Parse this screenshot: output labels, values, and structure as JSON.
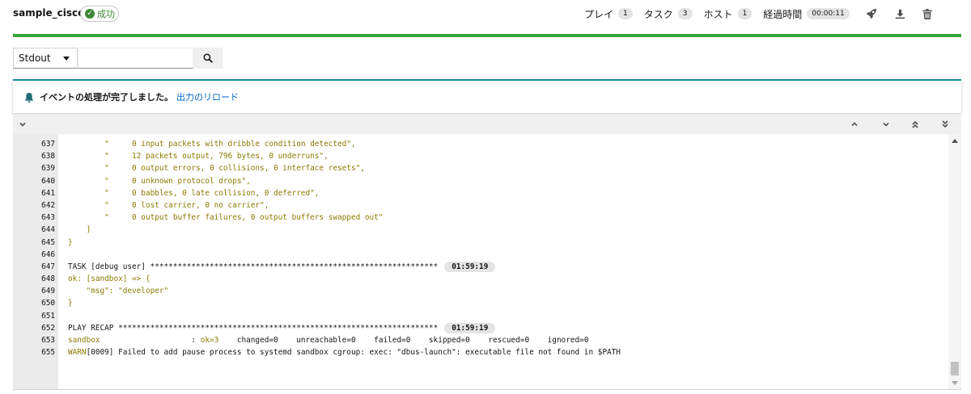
{
  "header": {
    "title": "sample_cisco",
    "status": "成功",
    "counts": [
      {
        "label": "プレイ",
        "value": "1"
      },
      {
        "label": "タスク",
        "value": "3"
      },
      {
        "label": "ホスト",
        "value": "1"
      },
      {
        "label": "経過時間",
        "value": "00:00:11"
      }
    ],
    "icons": [
      "rocket-icon",
      "download-icon",
      "delete-icon"
    ]
  },
  "colors": {
    "success": "#3e8635",
    "progress_bar": "#3ca739",
    "alert_border": "#1f8b9a",
    "link": "#0066cc",
    "output_ok": "#8a7a00"
  },
  "search": {
    "select_value": "Stdout",
    "input_value": "",
    "button_icon": "search-icon"
  },
  "alert": {
    "icon": "bell-icon",
    "message": "イベントの処理が完了しました。",
    "link": "出力のリロード"
  },
  "toolbar": {
    "icons": [
      "collapse-all-icon",
      "scroll-previous-icon",
      "scroll-next-icon",
      "scroll-first-icon",
      "scroll-last-icon"
    ]
  },
  "output": {
    "lines": [
      {
        "n": "637",
        "text": "        \"     0 input packets with dribble condition detected\",",
        "color": "gold"
      },
      {
        "n": "638",
        "text": "        \"     12 packets output, 796 bytes, 0 underruns\",",
        "color": "gold"
      },
      {
        "n": "639",
        "text": "        \"     0 output errors, 0 collisions, 0 interface resets\",",
        "color": "gold"
      },
      {
        "n": "640",
        "text": "        \"     0 unknown protocol drops\",",
        "color": "gold"
      },
      {
        "n": "641",
        "text": "        \"     0 babbles, 0 late collision, 0 deferred\",",
        "color": "gold"
      },
      {
        "n": "642",
        "text": "        \"     0 lost carrier, 0 no carrier\",",
        "color": "gold"
      },
      {
        "n": "643",
        "text": "        \"     0 output buffer failures, 0 output buffers swapped out\"",
        "color": "gold"
      },
      {
        "n": "644",
        "text": "    ]",
        "color": "gold"
      },
      {
        "n": "645",
        "text": "}",
        "color": "gold"
      },
      {
        "n": "646",
        "text": "",
        "color": "black"
      },
      {
        "n": "647",
        "text": "TASK [debug user] ***************************************************************",
        "color": "black",
        "time": "01:59:19"
      },
      {
        "n": "648",
        "text": "ok: [sandbox] => {",
        "color": "gold"
      },
      {
        "n": "649",
        "text": "    \"msg\": \"developer\"",
        "color": "gold"
      },
      {
        "n": "650",
        "text": "}",
        "color": "gold"
      },
      {
        "n": "651",
        "text": "",
        "color": "black"
      },
      {
        "n": "652",
        "text": "PLAY RECAP **********************************************************************",
        "color": "black",
        "time": "01:59:19"
      },
      {
        "n": "653",
        "parts": [
          {
            "text": "sandbox",
            "color": "gold"
          },
          {
            "text": "                    : ",
            "color": "black"
          },
          {
            "text": "ok=3",
            "color": "gold"
          },
          {
            "text": "    changed=0    unreachable=0    failed=0    skipped=0    rescued=0    ignored=0",
            "color": "black"
          }
        ]
      },
      {
        "n": "655",
        "parts": [
          {
            "text": "WARN",
            "color": "gold"
          },
          {
            "text": "[0009] Failed to add pause process to systemd sandbox cgroup: exec: \"dbus-launch\": executable file not found in $PATH",
            "color": "black"
          }
        ]
      }
    ]
  }
}
